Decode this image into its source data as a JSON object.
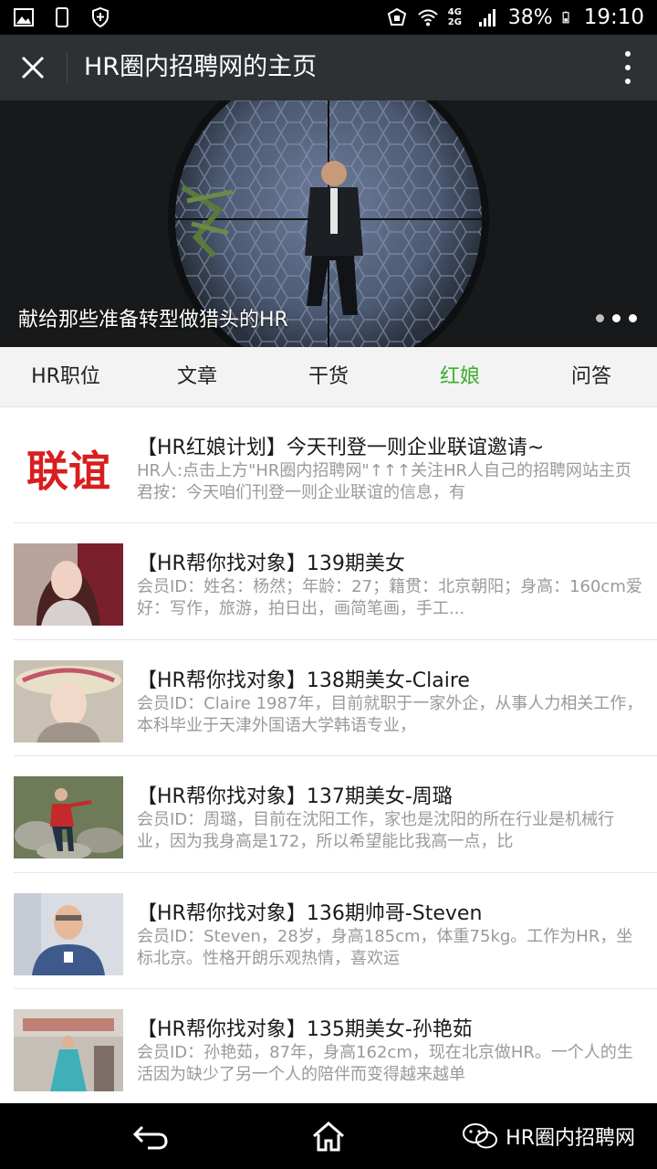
{
  "status_bar": {
    "icons_left": [
      "image-icon",
      "phone-icon",
      "shield-icon"
    ],
    "network": "4G 2G",
    "battery": "38%",
    "time": "19:10"
  },
  "title_bar": {
    "title": "HR圈内招聘网的主页"
  },
  "banner": {
    "caption": "献给那些准备转型做猎头的HR",
    "dots": 3,
    "active_dot": 1
  },
  "tabs": [
    {
      "label": "HR职位"
    },
    {
      "label": "文章"
    },
    {
      "label": "干货"
    },
    {
      "label": "红娘"
    },
    {
      "label": "问答"
    }
  ],
  "active_tab": "红娘",
  "accent_color": "#3cae2f",
  "articles": [
    {
      "title": "【HR红娘计划】今天刊登一则企业联谊邀请~",
      "desc": "HR人:点击上方\"HR圈内招聘网\"↑↑↑关注HR人自己的招聘网站主页君按：今天咱们刊登一则企业联谊的信息，有",
      "thumb_text": "联谊"
    },
    {
      "title": "【HR帮你找对象】139期美女",
      "desc": "会员ID：姓名：杨然；年龄：27；籍贯：北京朝阳；身高：160cm爱好：写作，旅游，拍日出，画简笔画，手工..."
    },
    {
      "title": "【HR帮你找对象】138期美女-Claire",
      "desc": "会员ID：Claire 1987年，目前就职于一家外企，从事人力相关工作，本科毕业于天津外国语大学韩语专业，"
    },
    {
      "title": "【HR帮你找对象】137期美女-周璐",
      "desc": "会员ID：周璐，目前在沈阳工作，家也是沈阳的所在行业是机械行业，因为我身高是172，所以希望能比我高一点，比"
    },
    {
      "title": "【HR帮你找对象】136期帅哥-Steven",
      "desc": "会员ID：Steven，28岁，身高185cm，体重75kg。工作为HR，坐标北京。性格开朗乐观热情，喜欢运"
    },
    {
      "title": "【HR帮你找对象】135期美女-孙艳茹",
      "desc": "会员ID：孙艳茹，87年，身高162cm，现在北京做HR。一个人的生活因为缺少了另一个人的陪伴而变得越来越单"
    }
  ],
  "watermark": "HR圈内招聘网"
}
